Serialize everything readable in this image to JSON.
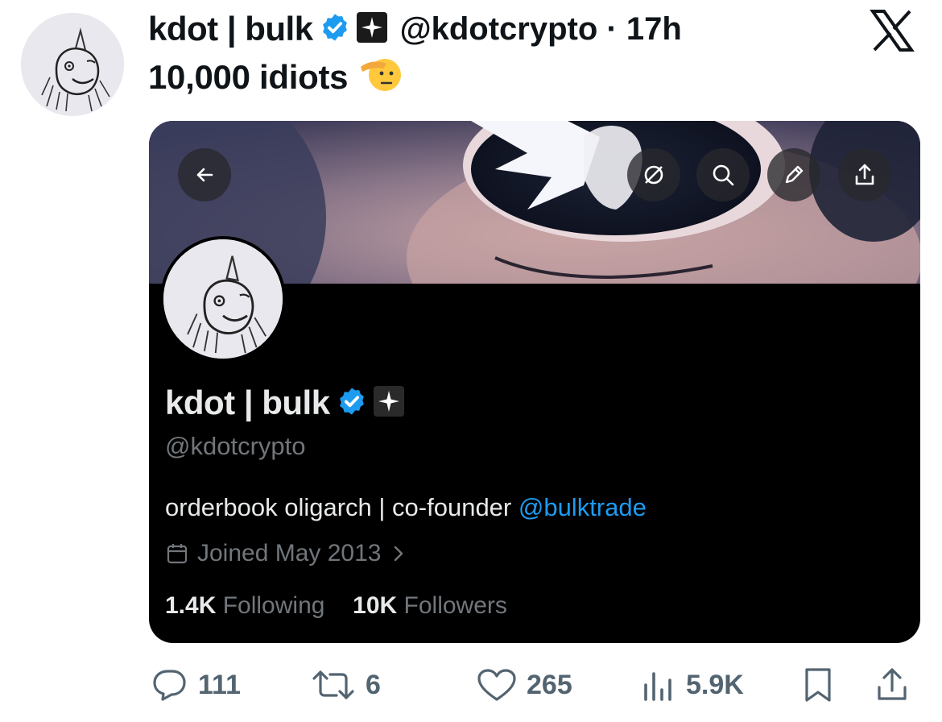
{
  "tweet": {
    "author_name": "kdot | bulk",
    "handle_time": "@kdotcrypto · 17h",
    "text": "10,000 idiots"
  },
  "profile_card": {
    "name": "kdot | bulk",
    "handle": "@kdotcrypto",
    "bio_text": "orderbook oligarch | co-founder ",
    "bio_mention": "@bulktrade",
    "joined": "Joined May 2013",
    "following_count": "1.4K",
    "following_label": "Following",
    "followers_count": "10K",
    "followers_label": "Followers",
    "buttons": [
      "back-arrow-icon",
      "grok-icon",
      "search-icon",
      "edit-pencil-icon",
      "share-icon"
    ]
  },
  "actions": {
    "replies": "111",
    "reposts": "6",
    "likes": "265",
    "views": "5.9K"
  },
  "colors": {
    "verified_blue": "#1d9bf0",
    "muted_gray": "#71767b",
    "action_gray": "#536471",
    "card_bg": "#000000"
  }
}
